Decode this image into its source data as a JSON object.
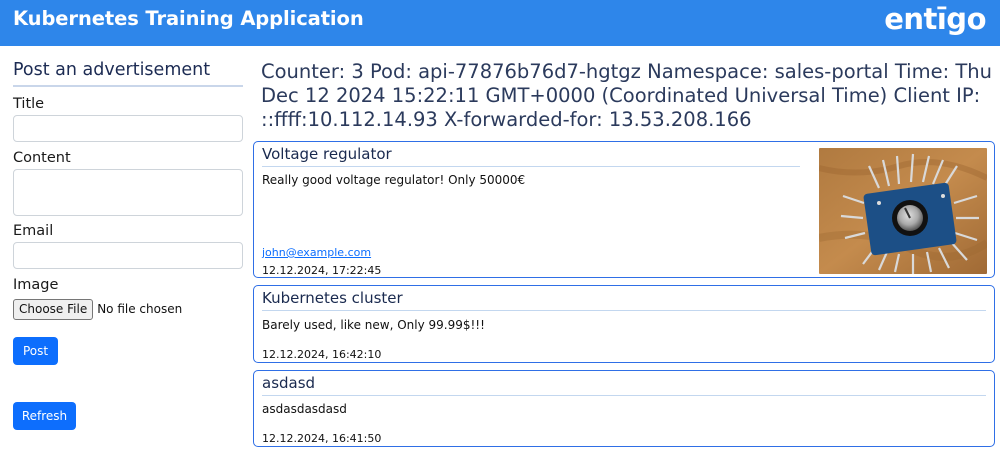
{
  "header": {
    "title": "Kubernetes Training Application",
    "logo_text": "entigo",
    "background_color": "#2e86ea"
  },
  "form": {
    "heading": "Post an advertisement",
    "title_label": "Title",
    "title_value": "",
    "content_label": "Content",
    "content_value": "",
    "email_label": "Email",
    "email_value": "",
    "image_label": "Image",
    "file_button_label": "Choose File",
    "file_status": "No file chosen",
    "post_button_label": "Post",
    "refresh_button_label": "Refresh"
  },
  "info": {
    "text": "Counter: 3 Pod: api-77876b76d7-hgtgz Namespace: sales-portal Time: Thu Dec 12 2024 15:22:11 GMT+0000 (Coordinated Universal Time) Client IP: ::ffff:10.112.14.93 X-forwarded-for: 13.53.208.166"
  },
  "ads": [
    {
      "title": "Voltage regulator",
      "content": "Really good voltage regulator! Only 50000€",
      "email": "john@example.com",
      "timestamp": "12.12.2024, 17:22:45",
      "has_image": true
    },
    {
      "title": "Kubernetes cluster",
      "content": "Barely used, like new, Only 99.99$!!!",
      "timestamp": "12.12.2024, 16:42:10"
    },
    {
      "title": "asdasd",
      "content": "asdasdasdasd",
      "timestamp": "12.12.2024, 16:41:50"
    }
  ],
  "colors": {
    "card_border": "#2f6fe6",
    "button_primary": "#0d6efd"
  }
}
